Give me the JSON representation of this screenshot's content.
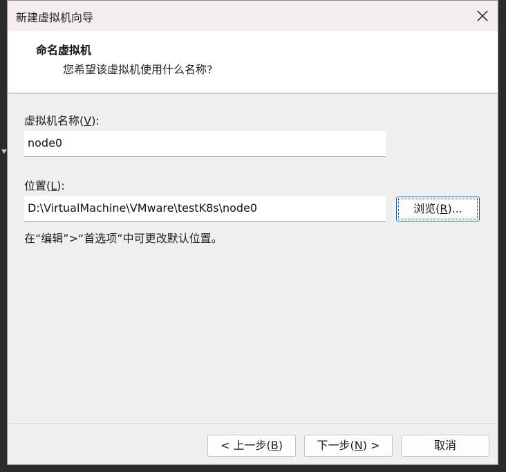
{
  "window": {
    "title": "新建虚拟机向导",
    "close_icon": "close-icon"
  },
  "header": {
    "title": "命名虚拟机",
    "subtitle": "您希望该虚拟机使用什么名称?"
  },
  "form": {
    "name_label_prefix": "虚拟机名称(",
    "name_label_key": "V",
    "name_label_suffix": "):",
    "name_value": "node0",
    "location_label_prefix": "位置(",
    "location_label_key": "L",
    "location_label_suffix": "):",
    "location_value": "D:\\VirtualMachine\\VMware\\testK8s\\node0",
    "browse_prefix": "浏览(",
    "browse_key": "R",
    "browse_suffix": ")...",
    "hint": "在“编辑”>“首选项”中可更改默认位置。"
  },
  "footer": {
    "back_prefix": "< 上一步(",
    "back_key": "B",
    "back_suffix": ")",
    "next_prefix": "下一步(",
    "next_key": "N",
    "next_suffix": ") >",
    "cancel": "取消"
  }
}
